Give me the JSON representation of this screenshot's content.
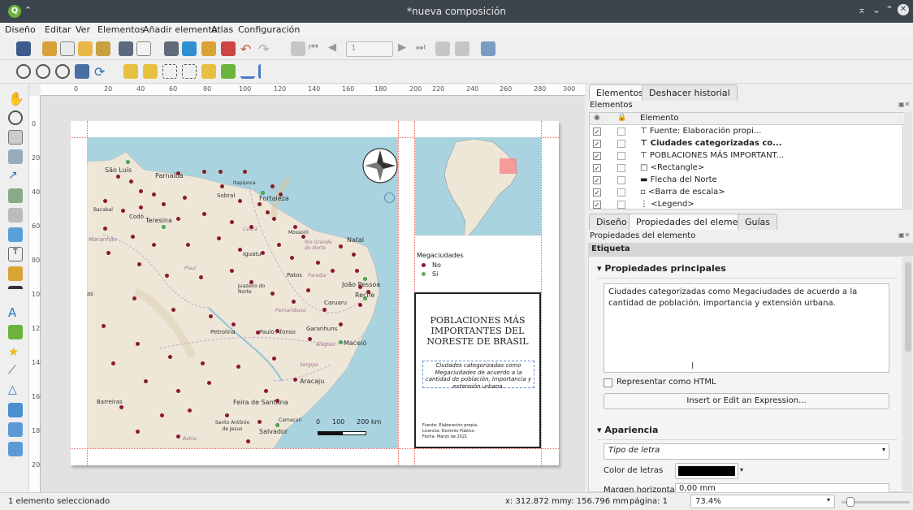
{
  "window": {
    "title": "*nueva composición"
  },
  "menu": [
    "Diseño",
    "Editar",
    "Ver",
    "Elementos",
    "Añadir elemento",
    "Atlas",
    "Configuración"
  ],
  "toolbar": {
    "page_number": "1"
  },
  "ruler": {
    "h_ticks": [
      "0",
      "20",
      "40",
      "60",
      "80",
      "100",
      "120",
      "140",
      "160",
      "180",
      "200",
      "220",
      "240",
      "260",
      "280",
      "300"
    ],
    "v_ticks": [
      "0",
      "20",
      "40",
      "60",
      "80",
      "100",
      "120",
      "140",
      "160",
      "180",
      "200"
    ]
  },
  "map": {
    "labels": [
      "São Luís",
      "Parnaíba",
      "Itapipoca",
      "Sobral",
      "Fortaleza",
      "Bacabal",
      "Codó",
      "Teresina",
      "Maranhão",
      "Ceará",
      "Mossoró",
      "Rio Grande do Norte",
      "Natal",
      "Iguatu",
      "Patos",
      "Paraíba",
      "João Pessoa",
      "Piauí",
      "Juazeiro do Norte",
      "Caruaru",
      "Recife",
      "Pernambuco",
      "Petrolina",
      "Paulo Afonso",
      "Garanhuns",
      "Alagoas",
      "Maceió",
      "Sergipe",
      "Aracaju",
      "Barreiras",
      "Feira de Santana",
      "Camaçari",
      "Santo Antônio de Jesus",
      "Salvador",
      "Bahia",
      "as"
    ],
    "scale": {
      "zero": "0",
      "mid": "100",
      "end": "200 km"
    }
  },
  "legend": {
    "title": "Megaciudades",
    "items": [
      "No",
      "Si"
    ]
  },
  "title_box": {
    "title": "POBLACIONES MÁS IMPORTANTES DEL NORESTE DE BRASIL",
    "subtitle": "Ciudades categorizadas como Megaciudades de acuerdo a la cantidad de población, importancia y extensión urbana.",
    "source": "Fuente: Elaboración propia.",
    "license": "Licencia: Dominio Público",
    "date": "Fecha: Marzo de 2021"
  },
  "panel": {
    "tabs_top": [
      "Elementos",
      "Deshacer historial"
    ],
    "elements_header": "Elementos",
    "col_element": "Elemento",
    "items": [
      "Fuente: Elaboración propi...",
      "Ciudades categorizadas co...",
      "POBLACIONES MÁS IMPORTANT...",
      "<Rectangle>",
      "Flecha del Norte",
      "<Barra de escala>",
      "<Legend>"
    ],
    "tabs_mid": [
      "Diseño",
      "Propiedades del elemento",
      "Guías"
    ],
    "props_header": "Propiedades del elemento",
    "section": "Etiqueta",
    "main_props": "Propiedades principales",
    "text_value": "Ciudades categorizadas como Megaciudades de acuerdo a la cantidad de población, importancia y extensión urbana.",
    "html_check": "Representar como HTML",
    "expr_btn": "Insert or Edit an Expression...",
    "appearance": "Apariencia",
    "font_btn": "Tipo de letra",
    "font_color_label": "Color de letras",
    "margin_label": "Margen horizontal",
    "margin_value": "0,00 mm"
  },
  "status": {
    "selection": "1 elemento seleccionado",
    "x": "x: 312.872 mm",
    "y": "y: 156.796 mm",
    "page": "página: 1",
    "zoom": "73.4%"
  }
}
